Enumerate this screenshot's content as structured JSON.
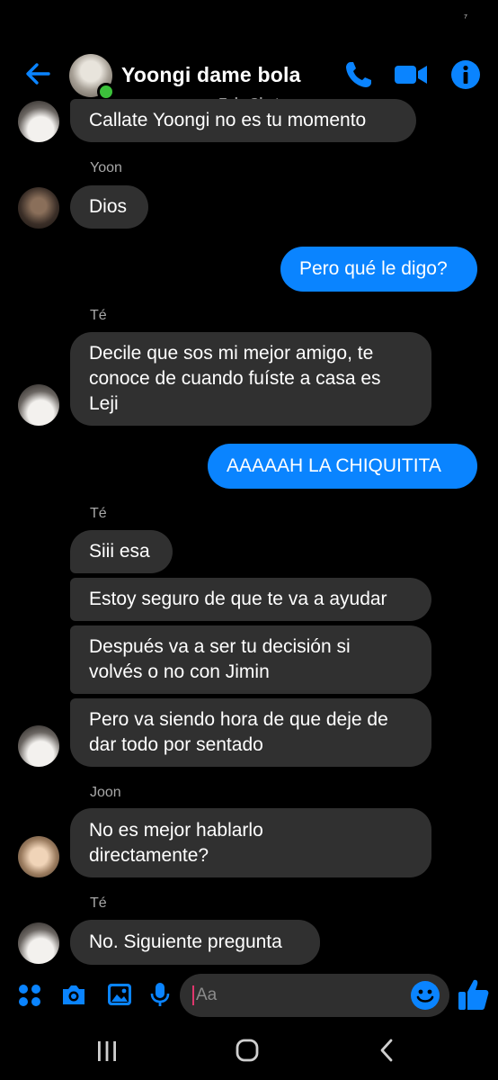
{
  "status_bar": {
    "glyph": "⁷"
  },
  "header": {
    "title": "Yoongi dame bola",
    "watermark": "FakeChat",
    "icons": [
      "back-arrow-icon",
      "phone-icon",
      "video-camera-icon",
      "info-icon"
    ],
    "accent": "#0a84ff"
  },
  "messages": {
    "m1": "Callate Yoongi no es tu momento",
    "s1": "Yoon",
    "m2": "Dios",
    "m3": "Pero qué le digo?",
    "s2": "Té",
    "m4a": "Decile que sos mi mejor amigo,  te",
    "m4b": "conoce de cuando fuíste a casa es",
    "m4c": "Leji",
    "m5": "AAAAAH LA CHIQUITITA",
    "s3": "Té",
    "m6": "Siii esa",
    "m7": "Estoy seguro de que te va a ayudar",
    "m8a": "Después va a ser tu decisión si",
    "m8b": "volvés o no con Jimin",
    "m9a": "Pero va siendo hora de que deje de",
    "m9b": "dar todo por sentado",
    "s4": "Joon",
    "m10a": "No es mejor hablarlo",
    "m10b": "directamente?",
    "s5": "Té",
    "m11": "No. Siguiente pregunta"
  },
  "composer": {
    "placeholder": "Aa",
    "icons": [
      "menu-dots-icon",
      "camera-icon",
      "image-icon",
      "microphone-icon",
      "emoji-icon",
      "like-icon"
    ]
  },
  "navbar": {
    "icons": [
      "recent-apps-icon",
      "home-icon",
      "back-icon"
    ]
  },
  "colors": {
    "incoming_bubble": "#303030",
    "outgoing_bubble": "#0a84ff",
    "background": "#000000"
  }
}
